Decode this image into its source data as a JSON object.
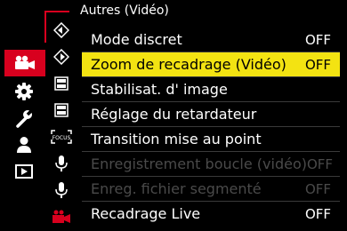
{
  "header": {
    "title": "Autres (Vidéo)"
  },
  "main_categories": [
    {
      "name": "video-camera-icon",
      "selected": true
    },
    {
      "name": "gear-icon",
      "selected": false
    },
    {
      "name": "wrench-icon",
      "selected": false
    },
    {
      "name": "person-icon",
      "selected": false
    },
    {
      "name": "playback-icon",
      "selected": false
    }
  ],
  "sub_icons": [
    "diamond-arrow-icon",
    "diamond-arrow-icon",
    "film-icon",
    "film-icon",
    "focus-icon",
    "microphone-icon",
    "microphone-icon",
    "red-camera-icon"
  ],
  "sub_icons_text": {
    "focus": "FOCUS"
  },
  "menu": {
    "items": [
      {
        "label": "Mode discret",
        "value": "OFF",
        "state": "normal"
      },
      {
        "label": "Zoom de recadrage (Vidéo)",
        "value": "OFF",
        "state": "selected"
      },
      {
        "label": "Stabilisat. d' image",
        "value": "",
        "state": "normal"
      },
      {
        "label": "Réglage du retardateur",
        "value": "",
        "state": "normal"
      },
      {
        "label": "Transition mise au point",
        "value": "",
        "state": "normal"
      },
      {
        "label": "Enregistrement boucle (vidéo)",
        "value": "OFF",
        "state": "disabled"
      },
      {
        "label": "Enreg. fichier segmenté",
        "value": "OFF",
        "state": "disabled"
      },
      {
        "label": "Recadrage Live",
        "value": "OFF",
        "state": "normal"
      }
    ]
  },
  "colors": {
    "accent": "#d8001e",
    "highlight": "#f3e312",
    "disabled": "#4a4a4a"
  }
}
